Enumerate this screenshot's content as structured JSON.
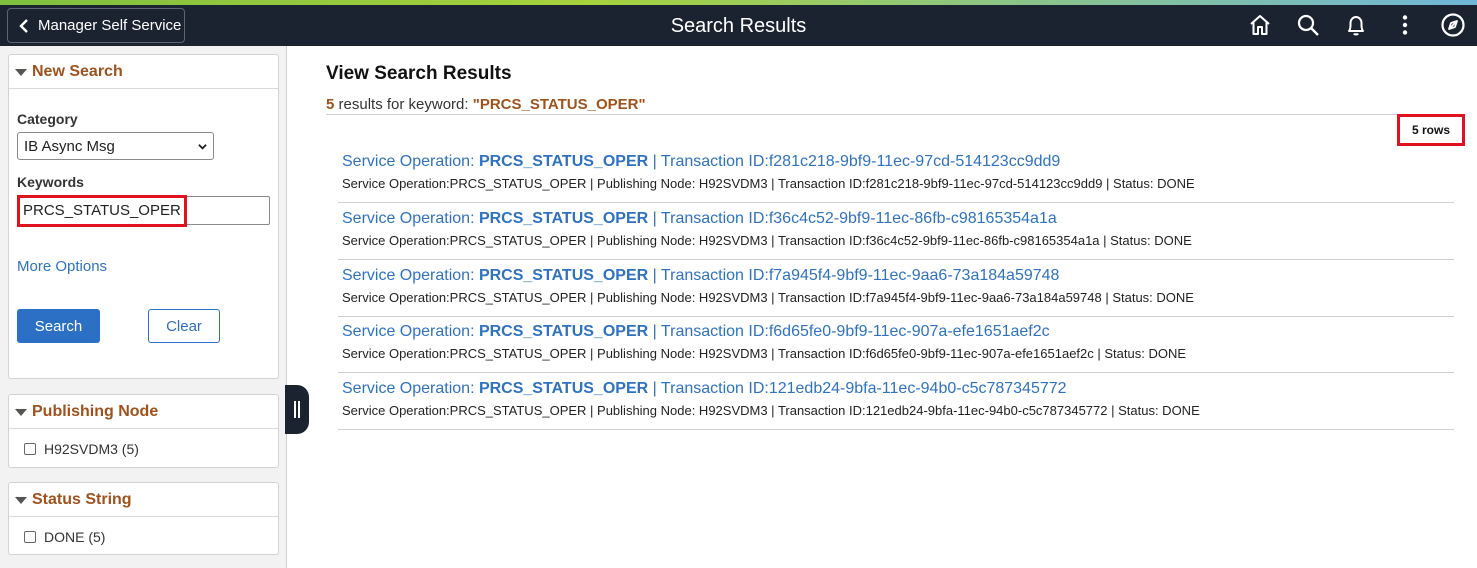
{
  "header": {
    "back_label": "Manager Self Service",
    "title": "Search Results",
    "icons": [
      "home-icon",
      "search-icon",
      "bell-icon",
      "more-options-icon",
      "navbar-compass-icon"
    ]
  },
  "left_panel": {
    "new_search": {
      "title": "New Search",
      "category_label": "Category",
      "category_value": "IB Async Msg",
      "keywords_label": "Keywords",
      "keywords_value": "PRCS_STATUS_OPER",
      "more_options": "More Options",
      "search_button": "Search",
      "clear_button": "Clear"
    },
    "facets": [
      {
        "title": "Publishing Node",
        "option": "H92SVDM3 (5)"
      },
      {
        "title": "Status String",
        "option": "DONE (5)"
      }
    ]
  },
  "main": {
    "title": "View Search Results",
    "summary_count": "5",
    "summary_text": " results for keyword: ",
    "summary_keyword": "\"PRCS_STATUS_OPER\"",
    "rows_label": "5 rows",
    "results": [
      {
        "title_prefix": "Service Operation: ",
        "title_bold": "PRCS_STATUS_OPER",
        "title_suffix": " | Transaction ID:f281c218-9bf9-11ec-97cd-514123cc9dd9",
        "description": "Service Operation:PRCS_STATUS_OPER | Publishing Node: H92SVDM3 | Transaction ID:f281c218-9bf9-11ec-97cd-514123cc9dd9 | Status: DONE"
      },
      {
        "title_prefix": "Service Operation: ",
        "title_bold": "PRCS_STATUS_OPER",
        "title_suffix": " | Transaction ID:f36c4c52-9bf9-11ec-86fb-c98165354a1a",
        "description": "Service Operation:PRCS_STATUS_OPER | Publishing Node: H92SVDM3 | Transaction ID:f36c4c52-9bf9-11ec-86fb-c98165354a1a | Status: DONE"
      },
      {
        "title_prefix": "Service Operation: ",
        "title_bold": "PRCS_STATUS_OPER",
        "title_suffix": " | Transaction ID:f7a945f4-9bf9-11ec-9aa6-73a184a59748",
        "description": "Service Operation:PRCS_STATUS_OPER | Publishing Node: H92SVDM3 | Transaction ID:f7a945f4-9bf9-11ec-9aa6-73a184a59748 | Status: DONE"
      },
      {
        "title_prefix": "Service Operation: ",
        "title_bold": "PRCS_STATUS_OPER",
        "title_suffix": " | Transaction ID:f6d65fe0-9bf9-11ec-907a-efe1651aef2c",
        "description": "Service Operation:PRCS_STATUS_OPER | Publishing Node: H92SVDM3 | Transaction ID:f6d65fe0-9bf9-11ec-907a-efe1651aef2c | Status: DONE"
      },
      {
        "title_prefix": "Service Operation: ",
        "title_bold": "PRCS_STATUS_OPER",
        "title_suffix": " | Transaction ID:121edb24-9bfa-11ec-94b0-c5c787345772",
        "description": "Service Operation:PRCS_STATUS_OPER | Publishing Node: H92SVDM3 | Transaction ID:121edb24-9bfa-11ec-94b0-c5c787345772 | Status: DONE"
      }
    ]
  },
  "colors": {
    "header_bg": "#1b2330",
    "link_blue": "#2f72c0",
    "accent_brown": "#a0521d",
    "highlight_red": "#e0121f",
    "button_blue": "#2b70c4"
  }
}
